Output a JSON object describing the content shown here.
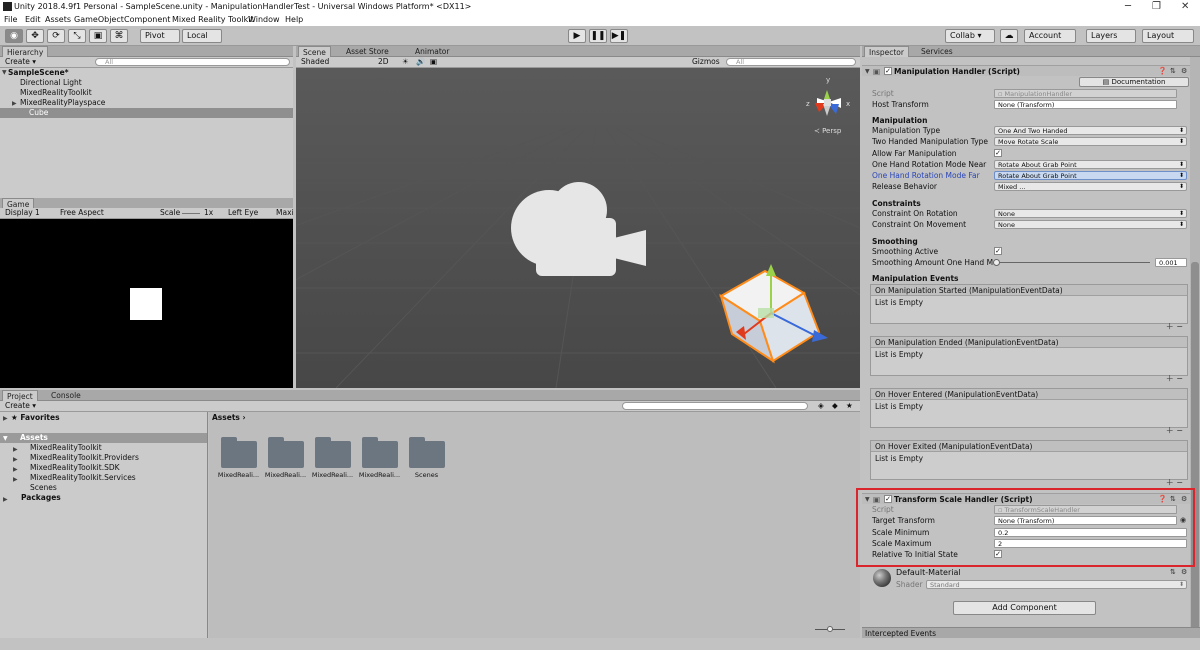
{
  "window": {
    "title": "Unity 2018.4.9f1 Personal - SampleScene.unity - ManipulationHandlerTest - Universal Windows Platform* <DX11>",
    "minimize": "─",
    "maximize": "❐",
    "close": "✕"
  },
  "menu": [
    "File",
    "Edit",
    "Assets",
    "GameObject",
    "Component",
    "Mixed Reality Toolkit",
    "Window",
    "Help"
  ],
  "toolbar": {
    "tools": [
      "◉",
      "✥",
      "⟳",
      "⤡",
      "▣",
      "⌘"
    ],
    "pivot": "Pivot",
    "local": "Local",
    "play": "▶",
    "pause": "❚❚",
    "step": "▶❚",
    "collab": "Collab ▾",
    "cloud": "☁",
    "account": "Account",
    "layers": "Layers",
    "layout": "Layout"
  },
  "hierarchy": {
    "tab": "Hierarchy",
    "create": "Create ▾",
    "search_placeholder": "All",
    "scene": "SampleScene*",
    "items": [
      "Directional Light",
      "MixedRealityToolkit",
      "MixedRealityPlayspace",
      "Cube"
    ]
  },
  "scene_view": {
    "tabs": [
      "Scene",
      "Asset Store",
      "Animator"
    ],
    "shaded": "Shaded",
    "mode2d": "2D",
    "gizmos": "Gizmos",
    "search_placeholder": "All",
    "persp": "≺ Persp",
    "axis_x": "x",
    "axis_y": "y",
    "axis_z": "z"
  },
  "game_view": {
    "tab": "Game",
    "display": "Display 1",
    "aspect": "Free Aspect",
    "scale_label": "Scale",
    "scale_value": "1x",
    "left_eye": "Left Eye",
    "maximize": "Maxi"
  },
  "project": {
    "tabs": [
      "Project",
      "Console"
    ],
    "create": "Create ▾",
    "favorites": "Favorites",
    "assets": "Assets",
    "asset_children": [
      "MixedRealityToolkit",
      "MixedRealityToolkit.Providers",
      "MixedRealityToolkit.SDK",
      "MixedRealityToolkit.Services",
      "Scenes"
    ],
    "packages": "Packages",
    "breadcrumb": "Assets ›",
    "tiles": [
      "MixedReali...",
      "MixedReali...",
      "MixedReali...",
      "MixedReali...",
      "Scenes"
    ]
  },
  "inspector": {
    "tabs": [
      "Inspector",
      "Services"
    ],
    "manip": {
      "title": "Manipulation Handler (Script)",
      "documentation": "Documentation",
      "script_label": "Script",
      "script_value": "ManipulationHandler",
      "host_label": "Host Transform",
      "host_value": "None (Transform)",
      "section_manipulation": "Manipulation",
      "manip_type_label": "Manipulation Type",
      "manip_type_value": "One And Two Handed",
      "two_hand_label": "Two Handed Manipulation Type",
      "two_hand_value": "Move Rotate Scale",
      "allow_far_label": "Allow Far Manipulation",
      "near_label": "One Hand Rotation Mode Near",
      "near_value": "Rotate About Grab Point",
      "far_label": "One Hand Rotation Mode Far",
      "far_value": "Rotate About Grab Point",
      "release_label": "Release Behavior",
      "release_value": "Mixed ...",
      "section_constraints": "Constraints",
      "c_rot_label": "Constraint On Rotation",
      "c_rot_value": "None",
      "c_mov_label": "Constraint On Movement",
      "c_mov_value": "None",
      "section_smoothing": "Smoothing",
      "smooth_active_label": "Smoothing Active",
      "smooth_amount_label": "Smoothing Amount One Hand Man",
      "smooth_amount_value": "0.001",
      "section_events": "Manipulation Events",
      "events": [
        {
          "title": "On Manipulation Started (ManipulationEventData)",
          "body": "List is Empty"
        },
        {
          "title": "On Manipulation Ended (ManipulationEventData)",
          "body": "List is Empty"
        },
        {
          "title": "On Hover Entered (ManipulationEventData)",
          "body": "List is Empty"
        },
        {
          "title": "On Hover Exited (ManipulationEventData)",
          "body": "List is Empty"
        }
      ]
    },
    "scale": {
      "title": "Transform Scale Handler (Script)",
      "script_label": "Script",
      "script_value": "TransformScaleHandler",
      "target_label": "Target Transform",
      "target_value": "None (Transform)",
      "min_label": "Scale Minimum",
      "min_value": "0.2",
      "max_label": "Scale Maximum",
      "max_value": "2",
      "relative_label": "Relative To Initial State"
    },
    "material": {
      "name": "Default-Material",
      "shader_label": "Shader",
      "shader_value": "Standard"
    },
    "add_component": "Add Component",
    "intercepted": "Intercepted Events"
  }
}
